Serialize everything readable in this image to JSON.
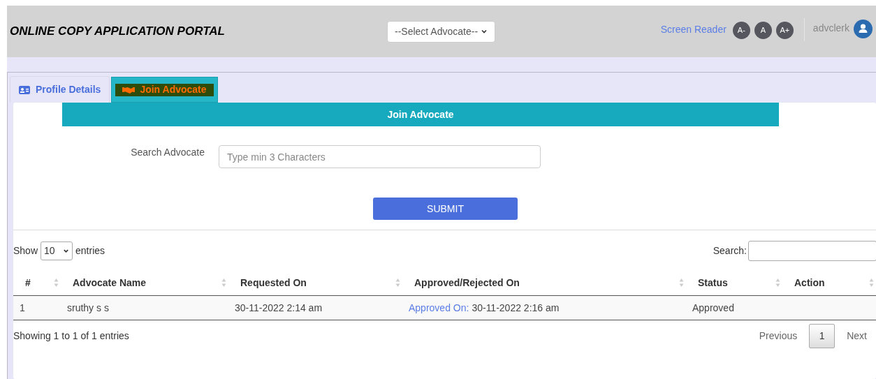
{
  "header": {
    "title": "ONLINE COPY APPLICATION PORTAL",
    "advocate_select": "--Select Advocate--",
    "screen_reader": "Screen Reader",
    "font_buttons": [
      "A-",
      "A",
      "A+"
    ],
    "user": "advclerk"
  },
  "tabs": [
    {
      "label": "Profile Details",
      "selected": false
    },
    {
      "label": "Join Advocate",
      "selected": true
    }
  ],
  "panel_title": "Join Advocate",
  "search_advocate": {
    "label": "Search Advocate",
    "placeholder": "Type min 3 Characters"
  },
  "submit": "SUBMIT",
  "table_controls": {
    "show": "Show",
    "page_size": "10",
    "entries": "entries",
    "search_label": "Search:"
  },
  "table": {
    "columns": [
      "#",
      "Advocate Name",
      "Requested On",
      "Approved/Rejected On",
      "Status",
      "Action"
    ],
    "rows": [
      {
        "index": "1",
        "name": "sruthy s s",
        "requested": "30-11-2022 2:14 am",
        "approved_label": "Approved On:",
        "approved_date": "30-11-2022 2:16 am",
        "status": "Approved"
      }
    ]
  },
  "info": "Showing 1 to 1 of 1 entries",
  "pagination": {
    "previous": "Previous",
    "pages": [
      {
        "label": "1",
        "selected": true
      }
    ],
    "next": "Next"
  }
}
